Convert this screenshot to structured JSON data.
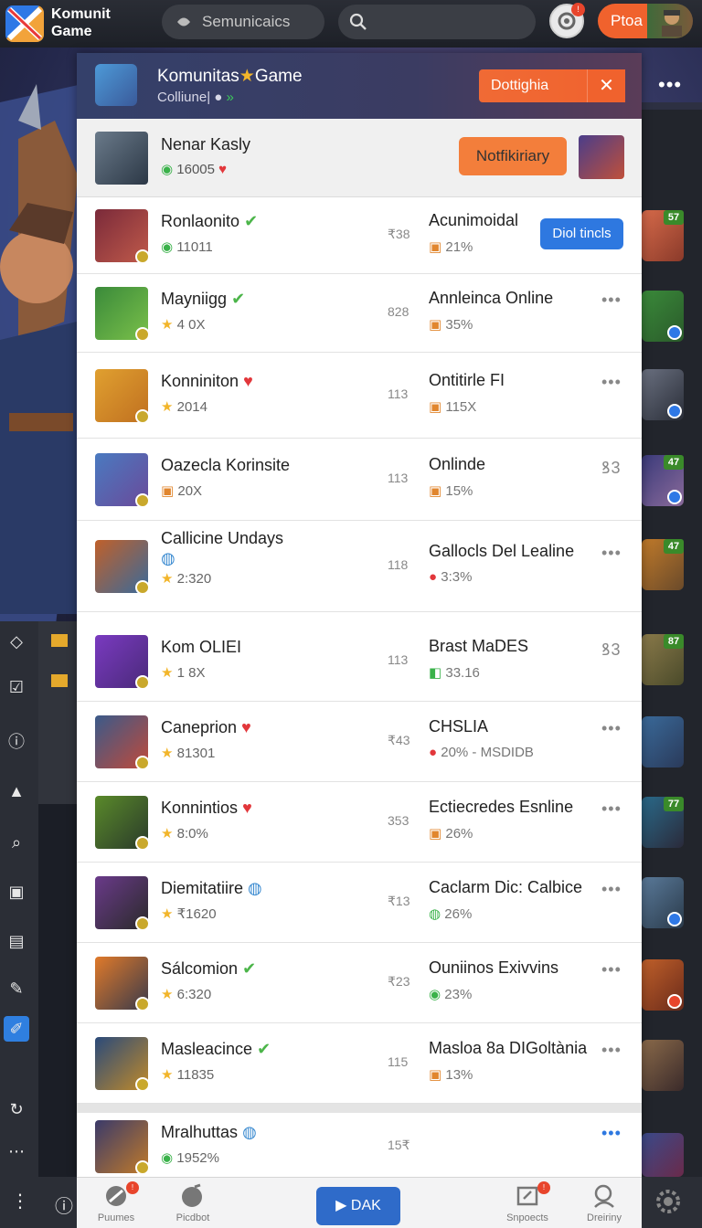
{
  "app": {
    "title": "Komunit Game"
  },
  "topbar": {
    "search_label": "Semunicaics",
    "search_placeholder": "",
    "notif_badge": "!",
    "pro_label": "Ptoa"
  },
  "panel": {
    "title": "Komunitas",
    "title_suffix": "Game",
    "subtitle": "Colliune|",
    "dismiss_label": "Dottighia",
    "dismiss_close": "✕",
    "more": "•••",
    "featured": {
      "name": "Nenar Kasly",
      "stat": "16005",
      "button": "Notfikiriary"
    },
    "rows": [
      {
        "name": "Ronlaonito",
        "stat": "11011",
        "num": "₹38",
        "name2": "Acunimoidal",
        "stat2": "21%",
        "action": "Diol tincls",
        "stat_icon": "coin",
        "stat2_icon": "box"
      },
      {
        "name": "Mayniigg",
        "stat": "4 0X",
        "num": "828",
        "name2": "Annleinca Online",
        "stat2": "35%",
        "action": "•••",
        "stat_icon": "star",
        "stat2_icon": "box"
      },
      {
        "name": "Konniniton",
        "stat": "2014",
        "num": "113",
        "name2": "Ontitirle FI",
        "stat2": "115X",
        "action": "•••",
        "stat_icon": "star",
        "stat2_icon": "box"
      },
      {
        "name": "Oazecla Korinsite",
        "stat": "20X",
        "num": "113",
        "name2": "Onlinde",
        "stat2": "15%",
        "action": "ꝸ3",
        "stat_icon": "box",
        "stat2_icon": "box"
      },
      {
        "name": "Callicine Undays",
        "stat": "2:320",
        "num": "118",
        "name2": "Gallocls Del Lealine",
        "stat2": "3:3%",
        "action": "•••",
        "stat_icon": "star",
        "stat2_icon": "heart"
      },
      {
        "name": "Kom OLIEI",
        "stat": "1 8X",
        "num": "113",
        "name2": "Brast MaDES",
        "stat2": "33.16",
        "action": "ꝸ3",
        "stat_icon": "star",
        "stat2_icon": "cube"
      },
      {
        "name": "Caneprion",
        "stat": "81301",
        "num": "₹43",
        "name2": "CHSLIA",
        "stat2": "20% - MSDIDB",
        "action": "•••",
        "stat_icon": "star",
        "stat2_icon": "heart"
      },
      {
        "name": "Konnintios",
        "stat": "8:0%",
        "num": "353",
        "name2": "Ectiecredes Esnline",
        "stat2": "26%",
        "action": "•••",
        "stat_icon": "star",
        "stat2_icon": "box"
      },
      {
        "name": "Diemitatiire",
        "stat": "₹1620",
        "num": "₹13",
        "name2": "Caclarm Dic: Calbice",
        "stat2": "26%",
        "action": "•••",
        "stat_icon": "star",
        "stat2_icon": "globe"
      },
      {
        "name": "Sálcomion",
        "stat": "6:320",
        "num": "₹23",
        "name2": "Ouniinos Exivvins",
        "stat2": "23%",
        "action": "•••",
        "stat_icon": "star",
        "stat2_icon": "coin"
      },
      {
        "name": "Masleacince",
        "stat": "11835",
        "num": "115",
        "name2": "Masloa 8a DIGoltània",
        "stat2": "13%",
        "action": "•••",
        "stat_icon": "star",
        "stat2_icon": "box"
      },
      {
        "name": "Mralhuttas",
        "stat": "1952%",
        "num": "15₹",
        "name2": "",
        "stat2": "",
        "action": "•••",
        "stat_icon": "coin",
        "stat2_icon": ""
      }
    ]
  },
  "right_strip": {
    "badges": [
      "57",
      "",
      "",
      "47",
      "47",
      "87",
      "",
      "77",
      "",
      "",
      "",
      ""
    ]
  },
  "bottom_nav": {
    "items": [
      {
        "label": "Puumes",
        "badge": "!"
      },
      {
        "label": "Picdbot",
        "badge": ""
      },
      {
        "label": "Snpoects",
        "badge": "!"
      },
      {
        "label": "Dreiriny",
        "badge": ""
      }
    ],
    "play_label": "DAK",
    "play_icon": "▶"
  },
  "colors": {
    "accent_orange": "#f0622d",
    "accent_blue": "#2e78e0",
    "star": "#f2b52a"
  }
}
